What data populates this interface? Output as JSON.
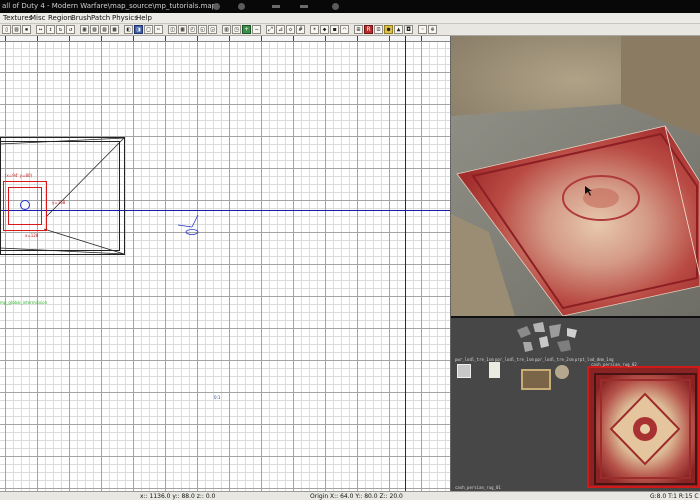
{
  "window": {
    "title": "all of Duty 4 - Modern Warfare\\map_source\\mp_tutorials.map"
  },
  "menu": {
    "items": [
      "Textures",
      "Misc",
      "Region",
      "Brush",
      "Patch",
      "Physics",
      "Help"
    ]
  },
  "grid_view": {
    "selection_size_label": "(x=94' y=80)",
    "selection_height_label": "y=158",
    "selection_width_label": "x=128",
    "entity_label": "mp_global_intermission",
    "area_label": "0:1"
  },
  "texture_browser": {
    "texture_names": [
      "pwr_lodl_tre_1sm",
      "ppr_lodl_tre_1sm",
      "ppr_lodl_tre_2sm",
      "prpt_lod_dnm_1ng",
      "cash_persian_rug_01",
      "cash_persian_rug_02"
    ],
    "selected_texture": "cash_persian_rug_01"
  },
  "status": {
    "coords": "x:: 1136.0  y:: 88.0  z:: 0.0",
    "origin": "Origin  X:: 64.0  Y:: 80.0  Z:: 20.0",
    "grid": "G:8.0 T:1 R:15 C"
  },
  "colors": {
    "axis": "#1a1ab0",
    "selection": "#d81818",
    "rug_red": "#b23a34",
    "texture_bg": "#474747"
  }
}
